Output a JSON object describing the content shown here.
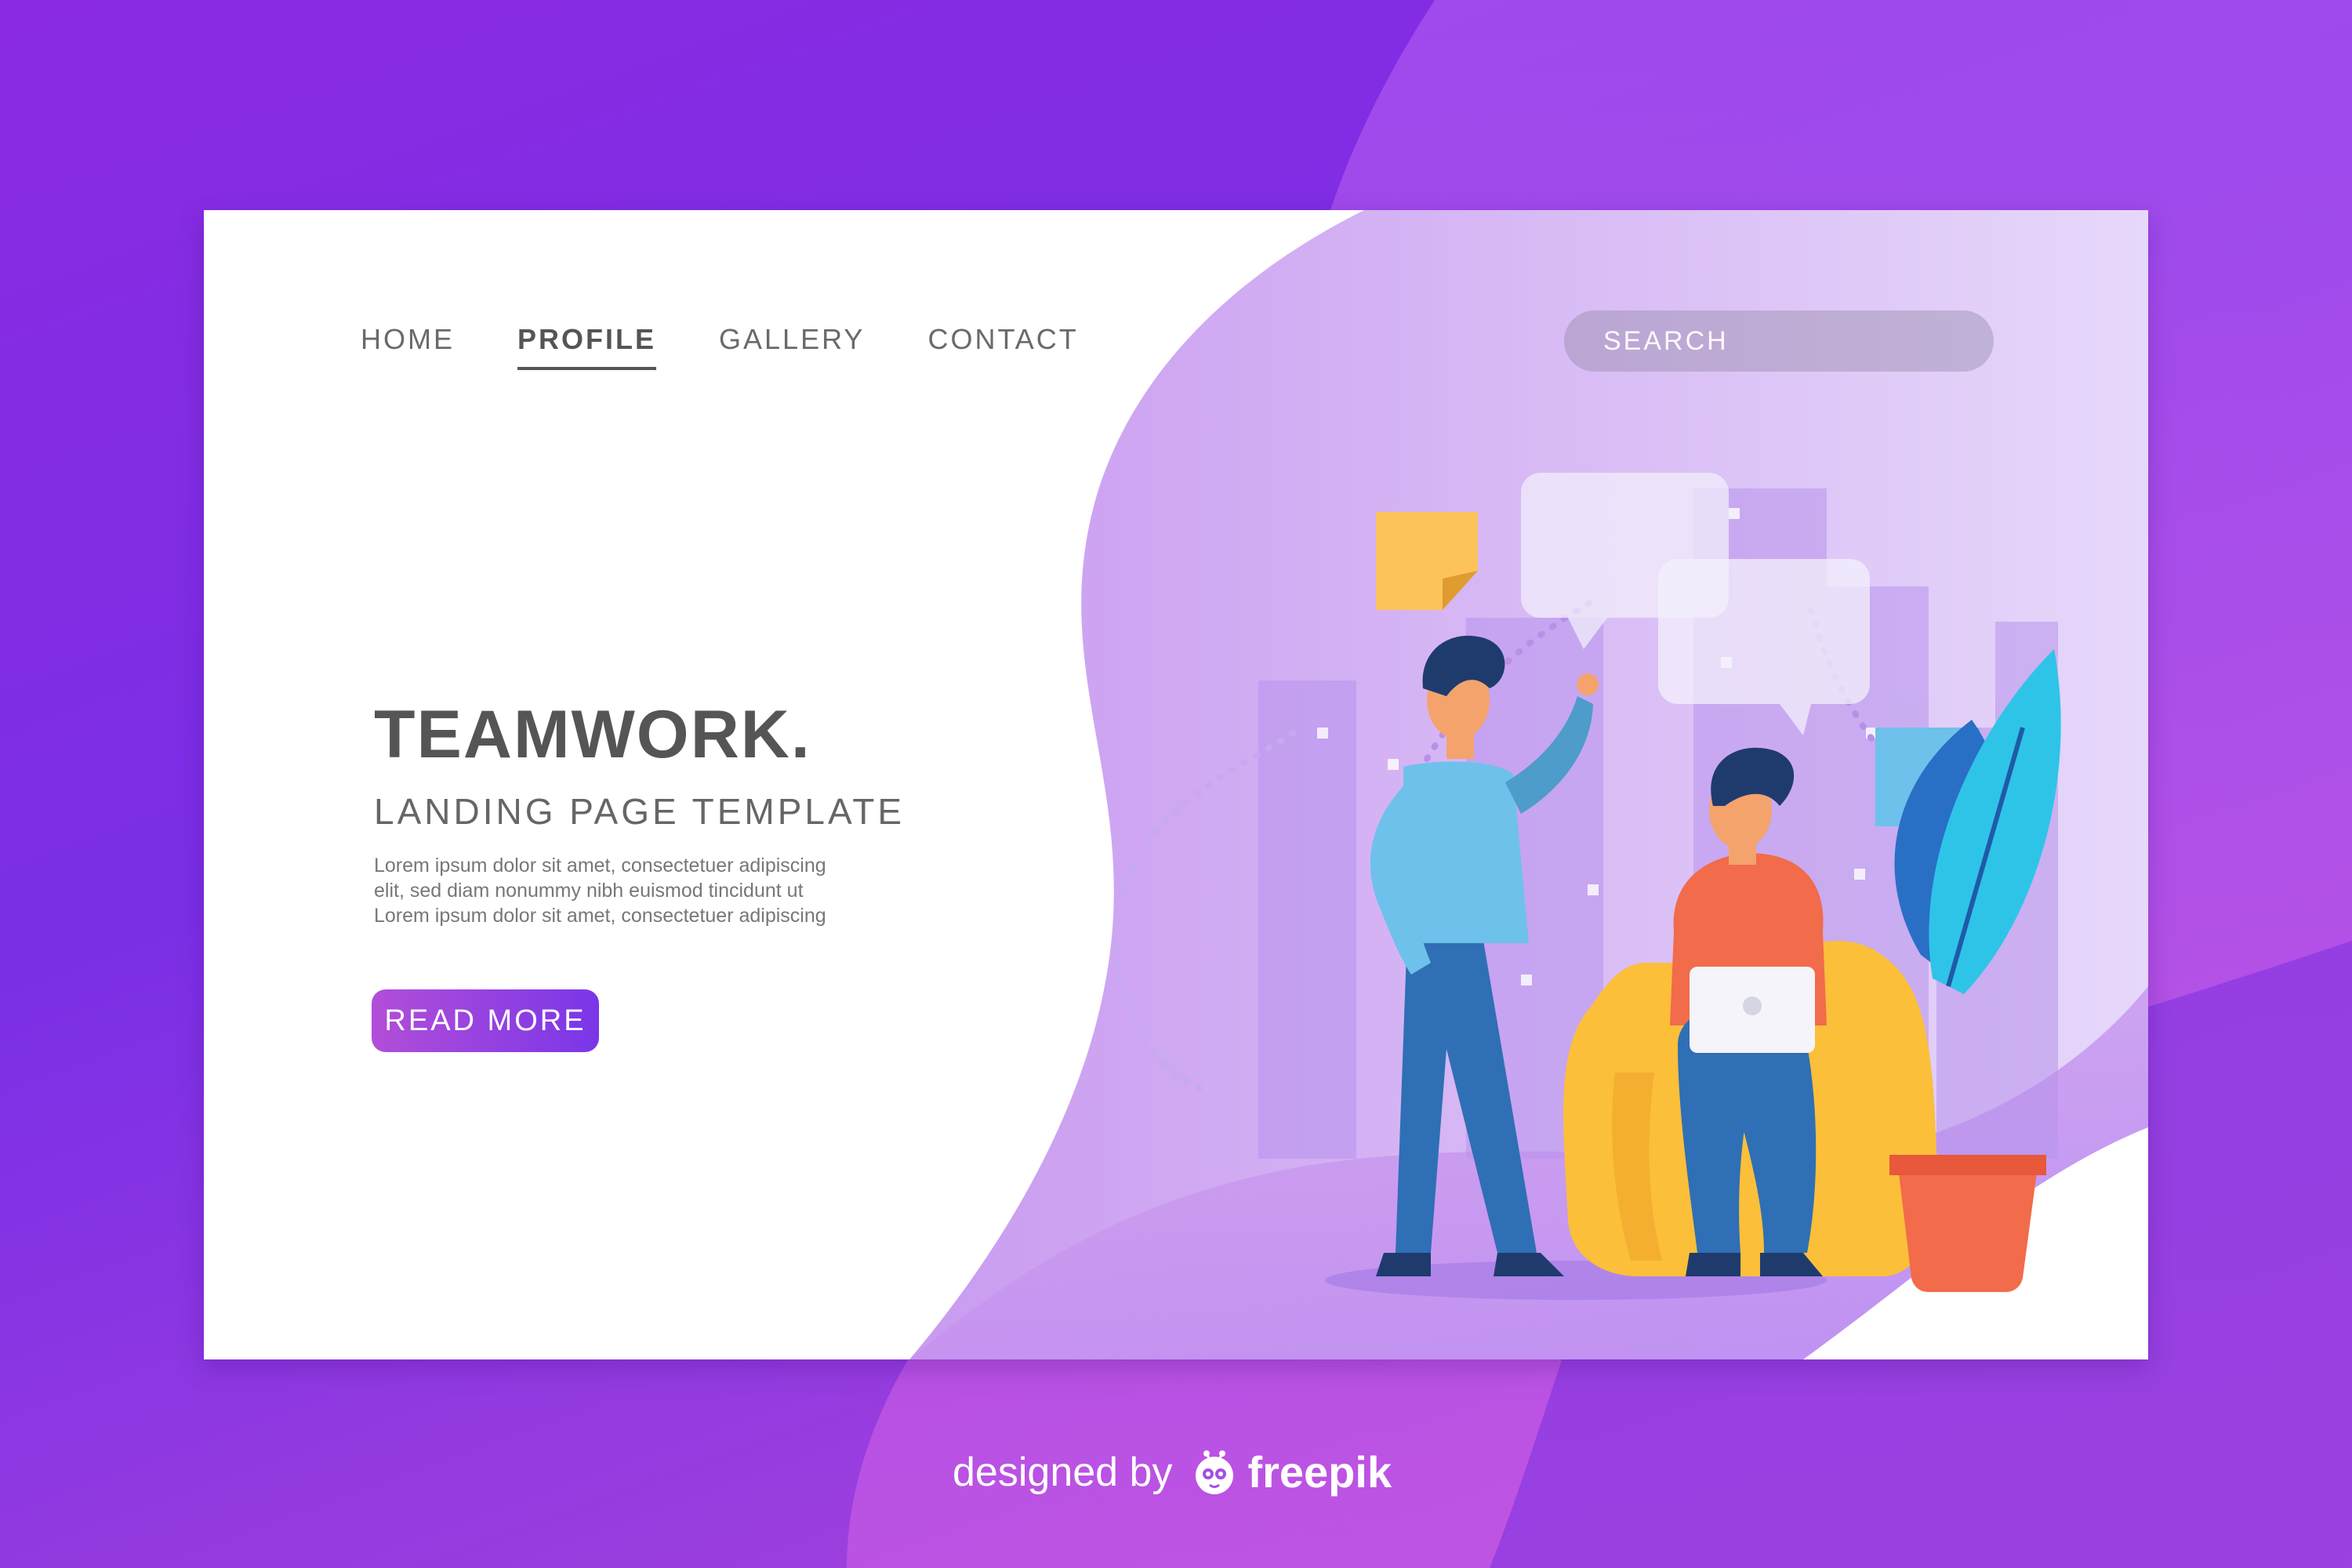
{
  "nav": {
    "items": [
      {
        "label": "HOME"
      },
      {
        "label": "PROFILE",
        "active": true
      },
      {
        "label": "GALLERY"
      },
      {
        "label": "CONTACT"
      }
    ]
  },
  "search": {
    "placeholder": "SEARCH"
  },
  "hero": {
    "title": "TEAMWORK.",
    "subtitle": "LANDING PAGE TEMPLATE",
    "body_lines": [
      "Lorem ipsum dolor sit amet, consectetuer adipiscing",
      "elit, sed diam nonummy nibh euismod tincidunt ut",
      "Lorem ipsum dolor sit amet, consectetuer adipiscing"
    ],
    "button_label": "READ MORE"
  },
  "credit": {
    "prefix": "designed by",
    "brand": "freepik",
    "logo_icon": "freepik-logo-icon"
  },
  "colors": {
    "background_purple": "#7b2ee6",
    "accent_magenta": "#b24ed8",
    "text_gray": "#555555",
    "skin_orange": "#f4a36c",
    "shirt_blue": "#6ec1ea",
    "pants_blue": "#2f6fb5",
    "sofa_yellow": "#fbbf3a",
    "pot_orange": "#f26b4a"
  }
}
